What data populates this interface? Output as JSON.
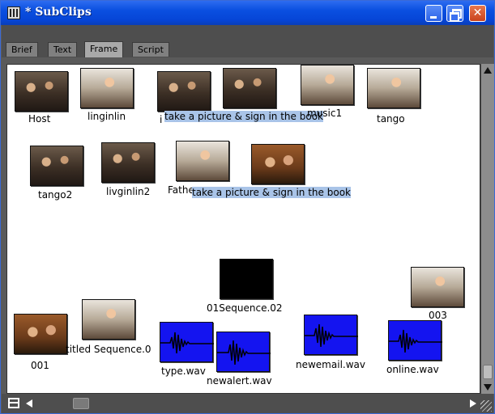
{
  "window": {
    "title": "* SubClips",
    "colors": {
      "titlebar": "#0645d6",
      "selection": "#a9c4e8",
      "audio_clip": "#1414f0",
      "canvas": "#ffffff",
      "chrome": "#4e4e4e"
    }
  },
  "tabs": [
    {
      "label": "Brief",
      "active": false
    },
    {
      "label": "Text",
      "active": false
    },
    {
      "label": "Frame",
      "active": true
    },
    {
      "label": "Script",
      "active": false
    }
  ],
  "clips": {
    "host": "Host",
    "linginlin": "linginlin",
    "take_picture_1": "take a picture & sign in the book",
    "take_picture_1_prefix": "i",
    "music1": "music1",
    "tango": "tango",
    "tango2": "tango2",
    "livginlin2": "livginlin2",
    "father": "Fathe",
    "take_picture_2": "take a picture & sign in the book",
    "sequence02": "01Sequence.02",
    "c003": "003",
    "c001": "001",
    "untitled_seq": "titled Sequence.0",
    "type_wav": "type.wav",
    "newalert_wav": "newalert.wav",
    "newemail_wav": "newemail.wav",
    "online_wav": "online.wav"
  },
  "icons": [
    "app-icon",
    "minimize-icon",
    "maximize-icon",
    "close-icon",
    "scroll-up-icon",
    "scroll-down-icon",
    "scroll-left-icon",
    "scroll-right-icon",
    "list-view-icon",
    "resize-grip-icon"
  ]
}
